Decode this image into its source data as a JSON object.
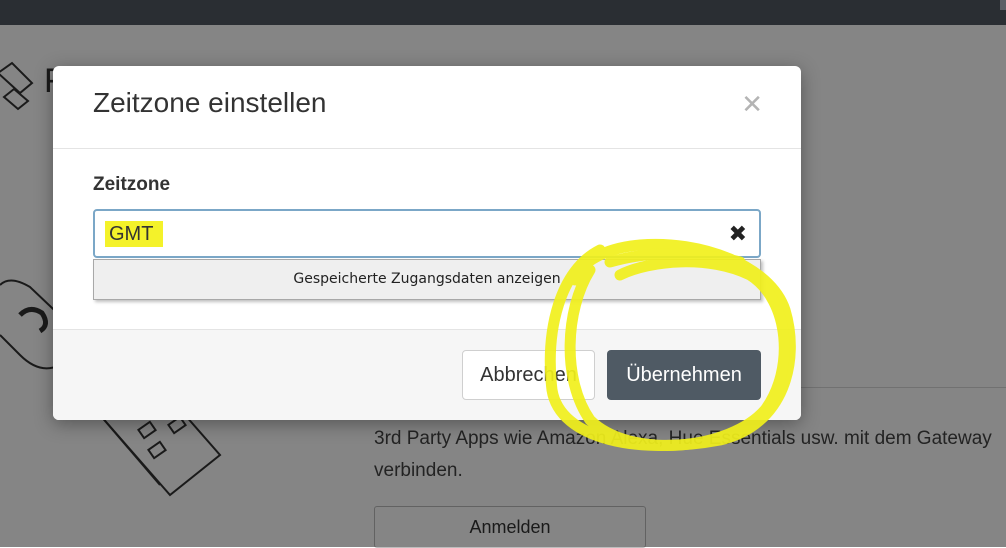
{
  "background": {
    "title_fragment": "F",
    "description": "3rd Party Apps wie Amazon Alexa, Hue Essentials usw. mit dem Gateway verbinden.",
    "button_label": "Anmelden"
  },
  "dialog": {
    "title": "Zeitzone einstellen",
    "close_icon": "close-icon",
    "field_label": "Zeitzone",
    "input_value": "GMT",
    "clear_icon": "clear-icon",
    "autofill_suggestion": "Gespeicherte Zugangsdaten anzeigen",
    "cancel_label": "Abbrechen",
    "apply_label": "Übernehmen"
  },
  "annotation": {
    "highlight_color": "#f4f22a",
    "scribble_color": "#f1f01c"
  },
  "colors": {
    "apply_button": "#4f5a64",
    "input_focus_border": "#7ba7c7",
    "topbar": "#2a2e33"
  }
}
